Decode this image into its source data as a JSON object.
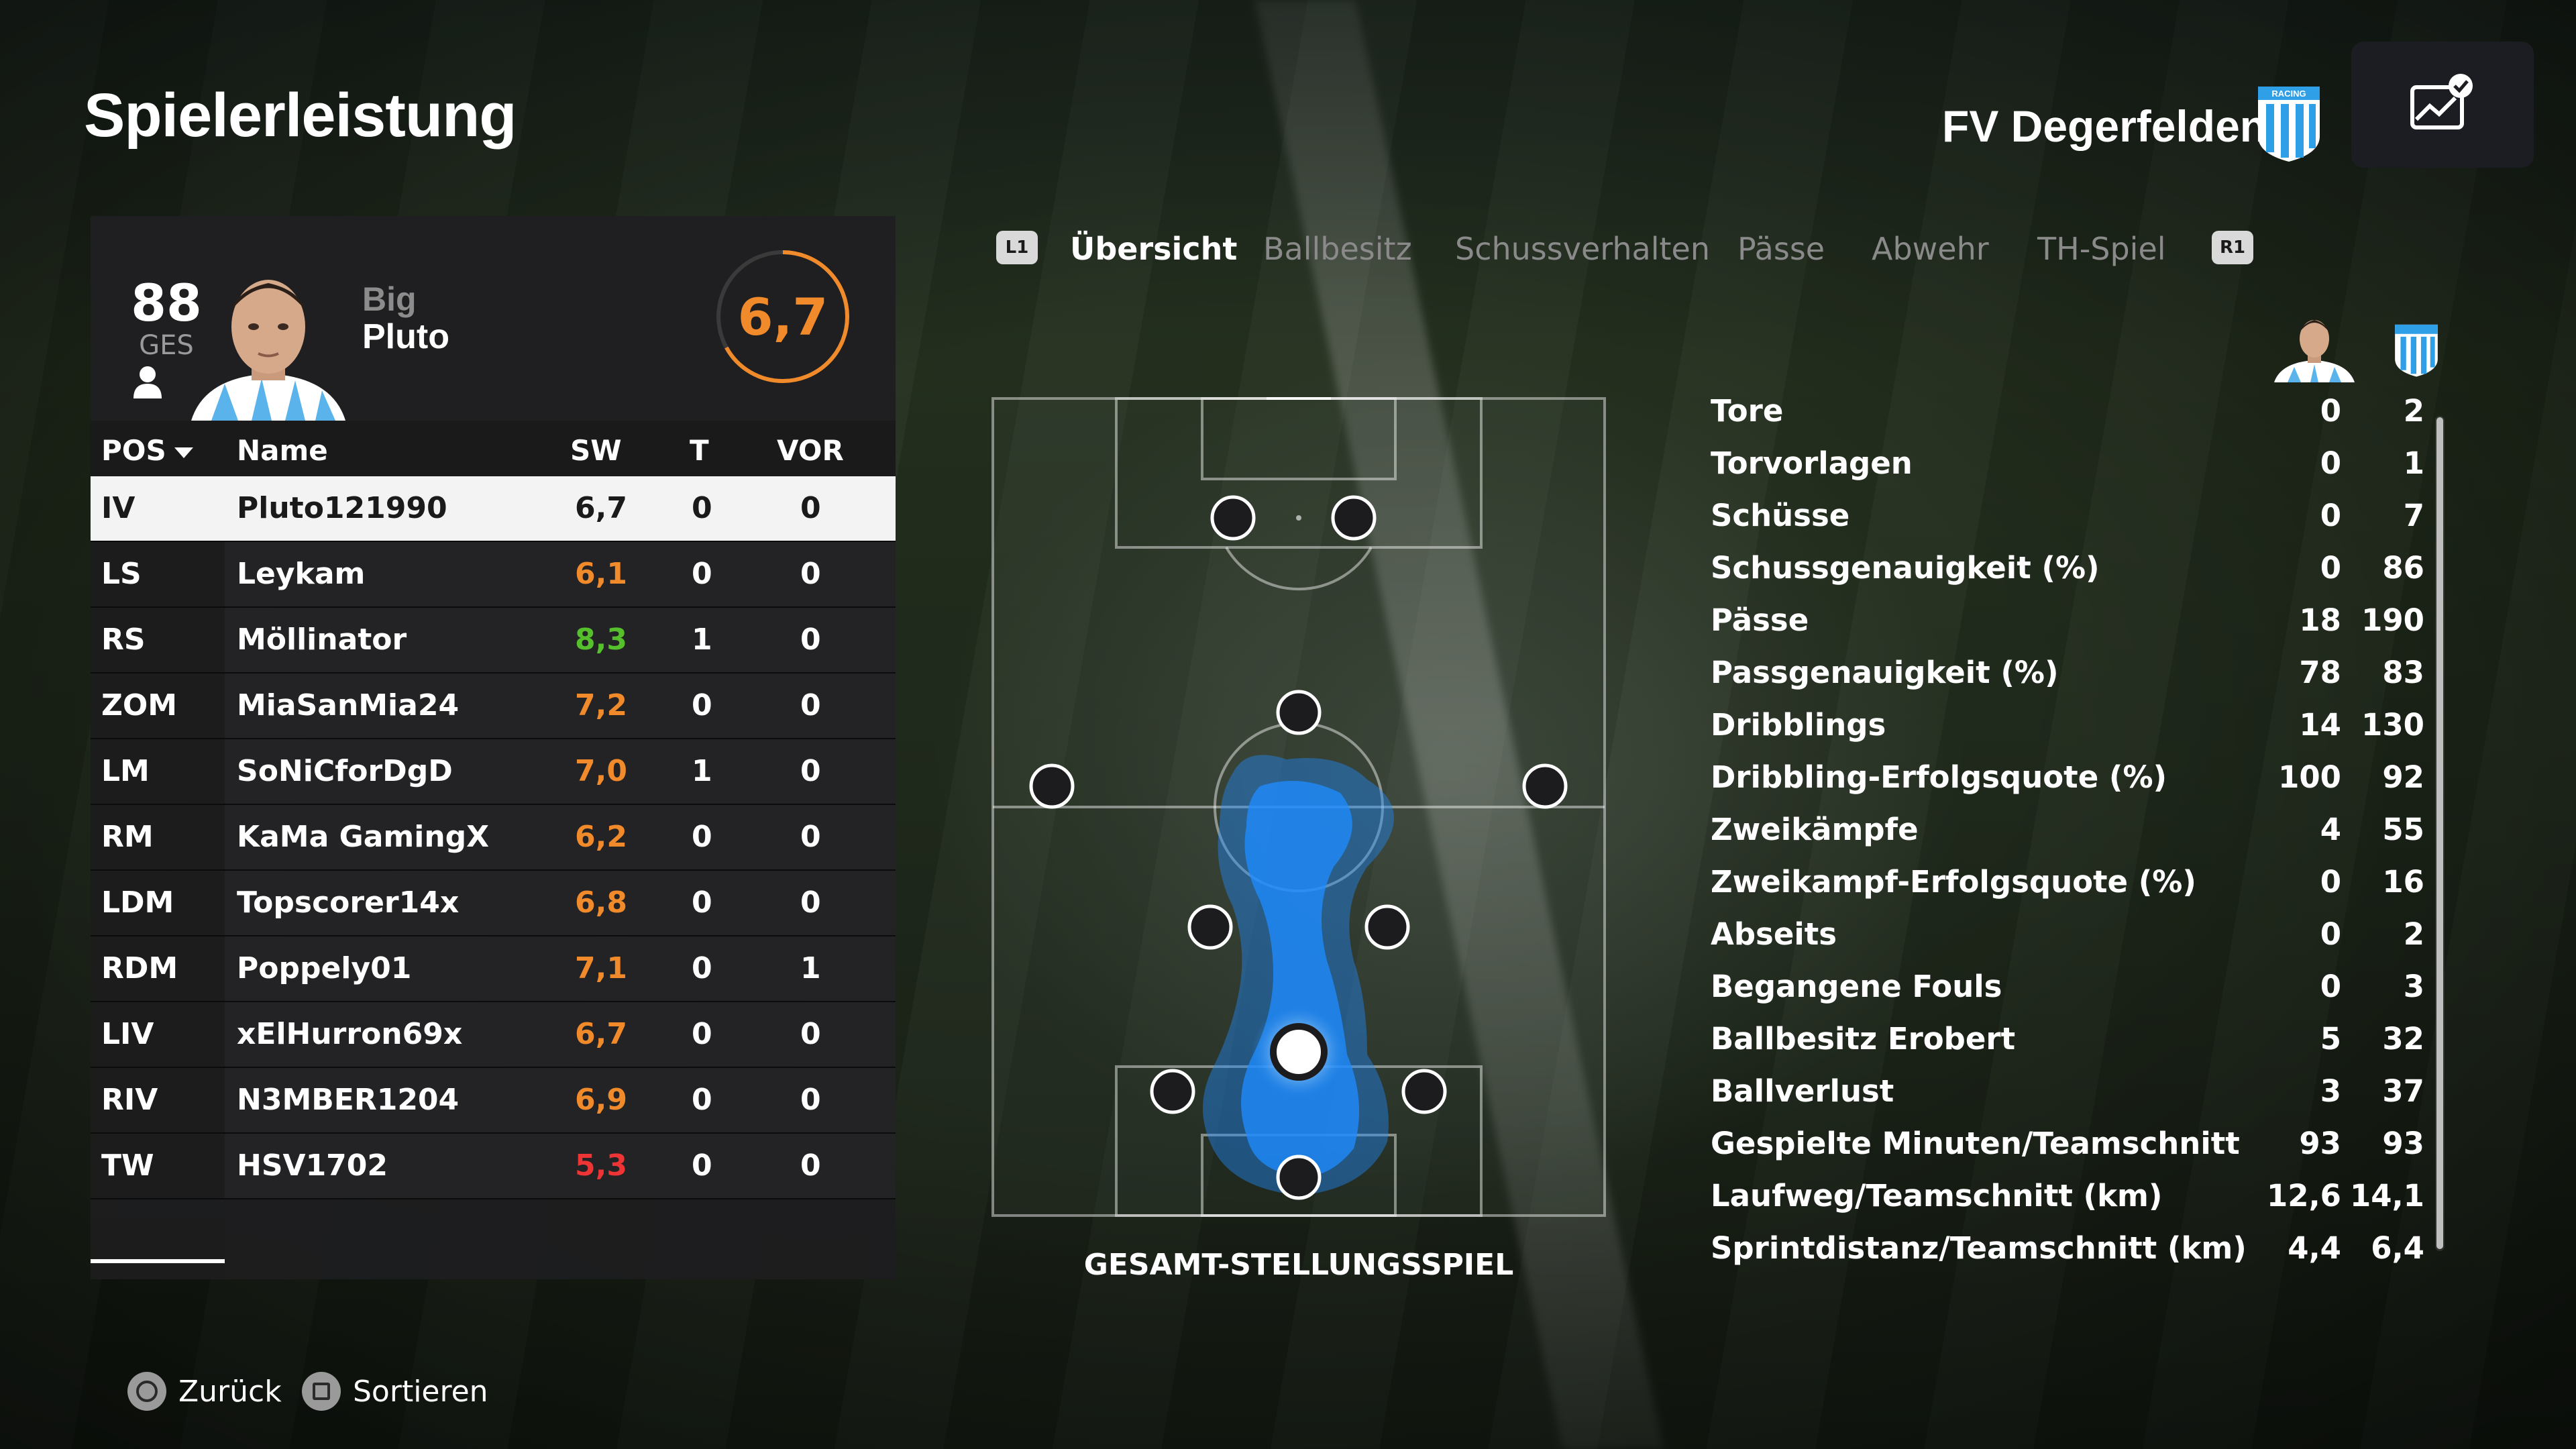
{
  "header": {
    "title": "Spielerleistung",
    "club_name": "FV Degerfelden",
    "crest_label": "RACING",
    "menu_icon": "chart-check-icon"
  },
  "player_card": {
    "overall": "88",
    "overall_label": "GES",
    "first_name": "Big",
    "last_name": "Pluto",
    "rating": "6,7",
    "rating_ring_color": "#f08a2a",
    "rating_fraction": 0.67
  },
  "table": {
    "columns": {
      "pos": "POS",
      "name": "Name",
      "sw": "SW",
      "t": "T",
      "vor": "VOR"
    },
    "rows": [
      {
        "pos": "IV",
        "name": "Pluto121990",
        "sw": "6,7",
        "t": "0",
        "vor": "0",
        "sw_color": "dark",
        "selected": true
      },
      {
        "pos": "LS",
        "name": "Leykam",
        "sw": "6,1",
        "t": "0",
        "vor": "0",
        "sw_color": "orange"
      },
      {
        "pos": "RS",
        "name": "Möllinator",
        "sw": "8,3",
        "t": "1",
        "vor": "0",
        "sw_color": "green"
      },
      {
        "pos": "ZOM",
        "name": "MiaSanMia24",
        "sw": "7,2",
        "t": "0",
        "vor": "0",
        "sw_color": "orange"
      },
      {
        "pos": "LM",
        "name": "SoNiCforDgD",
        "sw": "7,0",
        "t": "1",
        "vor": "0",
        "sw_color": "orange"
      },
      {
        "pos": "RM",
        "name": "KaMa GamingX",
        "sw": "6,2",
        "t": "0",
        "vor": "0",
        "sw_color": "orange"
      },
      {
        "pos": "LDM",
        "name": "Topscorer14x",
        "sw": "6,8",
        "t": "0",
        "vor": "0",
        "sw_color": "orange"
      },
      {
        "pos": "RDM",
        "name": "Poppely01",
        "sw": "7,1",
        "t": "0",
        "vor": "1",
        "sw_color": "orange"
      },
      {
        "pos": "LIV",
        "name": "xElHurron69x",
        "sw": "6,7",
        "t": "0",
        "vor": "0",
        "sw_color": "orange"
      },
      {
        "pos": "RIV",
        "name": "N3MBER1204",
        "sw": "6,9",
        "t": "0",
        "vor": "0",
        "sw_color": "orange"
      },
      {
        "pos": "TW",
        "name": "HSV1702",
        "sw": "5,3",
        "t": "0",
        "vor": "0",
        "sw_color": "red"
      }
    ]
  },
  "tabs": {
    "left_badge": "L1",
    "right_badge": "R1",
    "items": [
      "Übersicht",
      "Ballbesitz",
      "Schussverhalten",
      "Pässe",
      "Abwehr",
      "TH-Spiel"
    ],
    "active_index": 0
  },
  "pitch": {
    "caption": "GESAMT-STELLUNGSSPIEL"
  },
  "stats": {
    "rows": [
      {
        "label": "Tore",
        "player": "0",
        "team": "2"
      },
      {
        "label": "Torvorlagen",
        "player": "0",
        "team": "1"
      },
      {
        "label": "Schüsse",
        "player": "0",
        "team": "7"
      },
      {
        "label": "Schussgenauigkeit (%)",
        "player": "0",
        "team": "86"
      },
      {
        "label": "Pässe",
        "player": "18",
        "team": "190"
      },
      {
        "label": "Passgenauigkeit (%)",
        "player": "78",
        "team": "83"
      },
      {
        "label": "Dribblings",
        "player": "14",
        "team": "130"
      },
      {
        "label": "Dribbling-Erfolgsquote (%)",
        "player": "100",
        "team": "92"
      },
      {
        "label": "Zweikämpfe",
        "player": "4",
        "team": "55"
      },
      {
        "label": "Zweikampf-Erfolgsquote (%)",
        "player": "0",
        "team": "16"
      },
      {
        "label": "Abseits",
        "player": "0",
        "team": "2"
      },
      {
        "label": "Begangene Fouls",
        "player": "0",
        "team": "3"
      },
      {
        "label": "Ballbesitz Erobert",
        "player": "5",
        "team": "32"
      },
      {
        "label": "Ballverlust",
        "player": "3",
        "team": "37"
      },
      {
        "label": "Gespielte Minuten/Teamschnitt",
        "player": "93",
        "team": "93"
      },
      {
        "label": "Laufweg/Teamschnitt (km)",
        "player": "12,6",
        "team": "14,1"
      },
      {
        "label": "Sprintdistanz/Teamschnitt (km)",
        "player": "4,4",
        "team": "6,4"
      }
    ]
  },
  "footer": {
    "back_label": "Zurück",
    "sort_label": "Sortieren"
  },
  "colors": {
    "accent_orange": "#f08a2a",
    "green": "#55c02c",
    "red": "#ee3434",
    "heatmap_blue": "#1e8cff"
  }
}
